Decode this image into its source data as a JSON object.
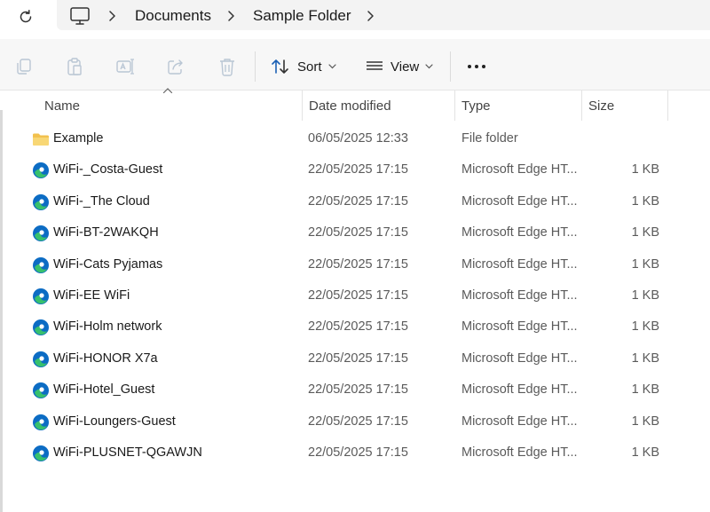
{
  "address_bar": {
    "refresh_icon": "refresh-icon",
    "location_icon": "monitor-icon",
    "breadcrumbs": [
      "Documents",
      "Sample Folder"
    ]
  },
  "command_bar": {
    "sort_label": "Sort",
    "view_label": "View",
    "disabled_icons": [
      "copy-icon",
      "paste-icon",
      "rename-icon",
      "share-icon",
      "delete-icon"
    ]
  },
  "columns": {
    "name": "Name",
    "date_modified": "Date modified",
    "type": "Type",
    "size": "Size"
  },
  "colors": {
    "folder": "#f2c14e",
    "edge_blue": "#0c6cc4",
    "edge_green": "#37c06d",
    "disabled_icon": "#b9c6d4"
  },
  "files": [
    {
      "name": "Example",
      "date": "06/05/2025 12:33",
      "type": "File folder",
      "size": "",
      "icon": "folder-icon"
    },
    {
      "name": "WiFi-_Costa-Guest",
      "date": "22/05/2025 17:15",
      "type": "Microsoft Edge HT...",
      "size": "1 KB",
      "icon": "edge-icon"
    },
    {
      "name": "WiFi-_The Cloud",
      "date": "22/05/2025 17:15",
      "type": "Microsoft Edge HT...",
      "size": "1 KB",
      "icon": "edge-icon"
    },
    {
      "name": "WiFi-BT-2WAKQH",
      "date": "22/05/2025 17:15",
      "type": "Microsoft Edge HT...",
      "size": "1 KB",
      "icon": "edge-icon"
    },
    {
      "name": "WiFi-Cats Pyjamas",
      "date": "22/05/2025 17:15",
      "type": "Microsoft Edge HT...",
      "size": "1 KB",
      "icon": "edge-icon"
    },
    {
      "name": "WiFi-EE WiFi",
      "date": "22/05/2025 17:15",
      "type": "Microsoft Edge HT...",
      "size": "1 KB",
      "icon": "edge-icon"
    },
    {
      "name": "WiFi-Holm network",
      "date": "22/05/2025 17:15",
      "type": "Microsoft Edge HT...",
      "size": "1 KB",
      "icon": "edge-icon"
    },
    {
      "name": "WiFi-HONOR X7a",
      "date": "22/05/2025 17:15",
      "type": "Microsoft Edge HT...",
      "size": "1 KB",
      "icon": "edge-icon"
    },
    {
      "name": "WiFi-Hotel_Guest",
      "date": "22/05/2025 17:15",
      "type": "Microsoft Edge HT...",
      "size": "1 KB",
      "icon": "edge-icon"
    },
    {
      "name": "WiFi-Loungers-Guest",
      "date": "22/05/2025 17:15",
      "type": "Microsoft Edge HT...",
      "size": "1 KB",
      "icon": "edge-icon"
    },
    {
      "name": "WiFi-PLUSNET-QGAWJN",
      "date": "22/05/2025 17:15",
      "type": "Microsoft Edge HT...",
      "size": "1 KB",
      "icon": "edge-icon"
    }
  ]
}
